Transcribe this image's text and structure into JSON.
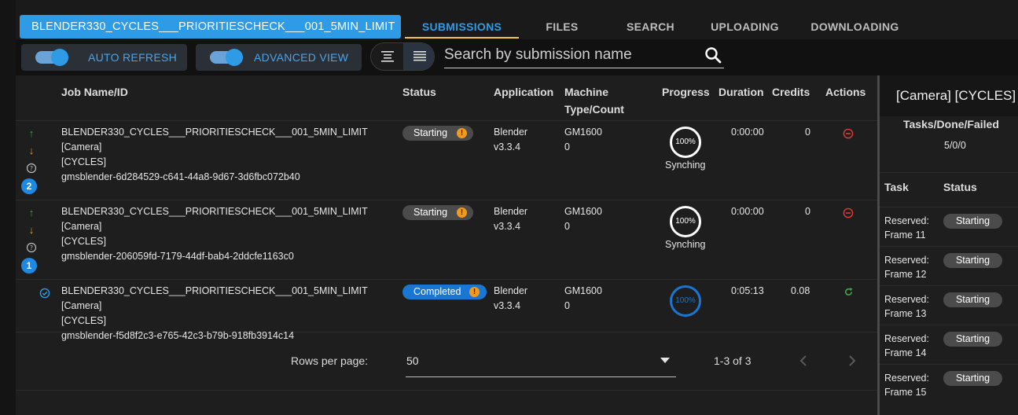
{
  "header": {
    "job_title": "BLENDER330_CYCLES___PRIORITIESCHECK___001_5MIN_LIMIT",
    "tabs": [
      "SUBMISSIONS",
      "FILES",
      "SEARCH",
      "UPLOADING",
      "DOWNLOADING"
    ],
    "active_tab": "SUBMISSIONS"
  },
  "toolbar": {
    "auto_refresh_label": "AUTO REFRESH",
    "advanced_view_label": "ADVANCED VIEW",
    "search_placeholder": "Search by submission name"
  },
  "table": {
    "columns": {
      "job": "Job Name/ID",
      "status": "Status",
      "application": "Application",
      "machine_1": "Machine",
      "machine_2": "Type/Count",
      "progress": "Progress",
      "duration": "Duration",
      "credits": "Credits",
      "actions": "Actions"
    },
    "rows": [
      {
        "name_1": "BLENDER330_CYCLES___PRIORITIESCHECK___001_5MIN_LIMIT [Camera]",
        "name_2": "[CYCLES]",
        "id": "gmsblender-6d284529-c641-44a8-9d67-3d6fbc072b40",
        "priority": "2",
        "status": "Starting",
        "app_name": "Blender",
        "app_version": "v3.3.4",
        "machine": "GM1600",
        "count": "0",
        "progress": "100%",
        "progress_label": "Synching",
        "duration": "0:00:00",
        "credits": "0"
      },
      {
        "name_1": "BLENDER330_CYCLES___PRIORITIESCHECK___001_5MIN_LIMIT [Camera]",
        "name_2": "[CYCLES]",
        "id": "gmsblender-206059fd-7179-44df-bab4-2ddcfe1163c0",
        "priority": "1",
        "status": "Starting",
        "app_name": "Blender",
        "app_version": "v3.3.4",
        "machine": "GM1600",
        "count": "0",
        "progress": "100%",
        "progress_label": "Synching",
        "duration": "0:00:00",
        "credits": "0"
      },
      {
        "name_1": "BLENDER330_CYCLES___PRIORITIESCHECK___001_5MIN_LIMIT [Camera]",
        "name_2": "[CYCLES]",
        "id": "gmsblender-f5d8f2c3-e765-42c3-b79b-918fb3914c14",
        "status": "Completed",
        "app_name": "Blender",
        "app_version": "v3.3.4",
        "machine": "GM1600",
        "count": "0",
        "progress": "100%",
        "duration": "0:05:13",
        "credits": "0.08"
      }
    ]
  },
  "pagination": {
    "rows_per_page_label": "Rows per page:",
    "rows_per_page": "50",
    "range": "1-3 of 3"
  },
  "panel": {
    "title": "[Camera] [CYCLES] -",
    "summary_label": "Tasks/Done/Failed",
    "summary_value": "5/0/0",
    "col_task": "Task",
    "col_status": "Status",
    "tasks": [
      {
        "line1": "Reserved:",
        "line2": "Frame 11",
        "status": "Starting"
      },
      {
        "line1": "Reserved:",
        "line2": "Frame 12",
        "status": "Starting"
      },
      {
        "line1": "Reserved:",
        "line2": "Frame 13",
        "status": "Starting"
      },
      {
        "line1": "Reserved:",
        "line2": "Frame 14",
        "status": "Starting"
      },
      {
        "line1": "Reserved:",
        "line2": "Frame 15",
        "status": "Starting"
      }
    ]
  },
  "colors": {
    "accent": "#2e9be6",
    "tab_underline": "#f4c24b",
    "status_gray": "#4b4b4b",
    "status_blue": "#1976d2",
    "info_orange": "#f39a1e",
    "cancel_red": "#e53935",
    "retry_green": "#43a047"
  }
}
